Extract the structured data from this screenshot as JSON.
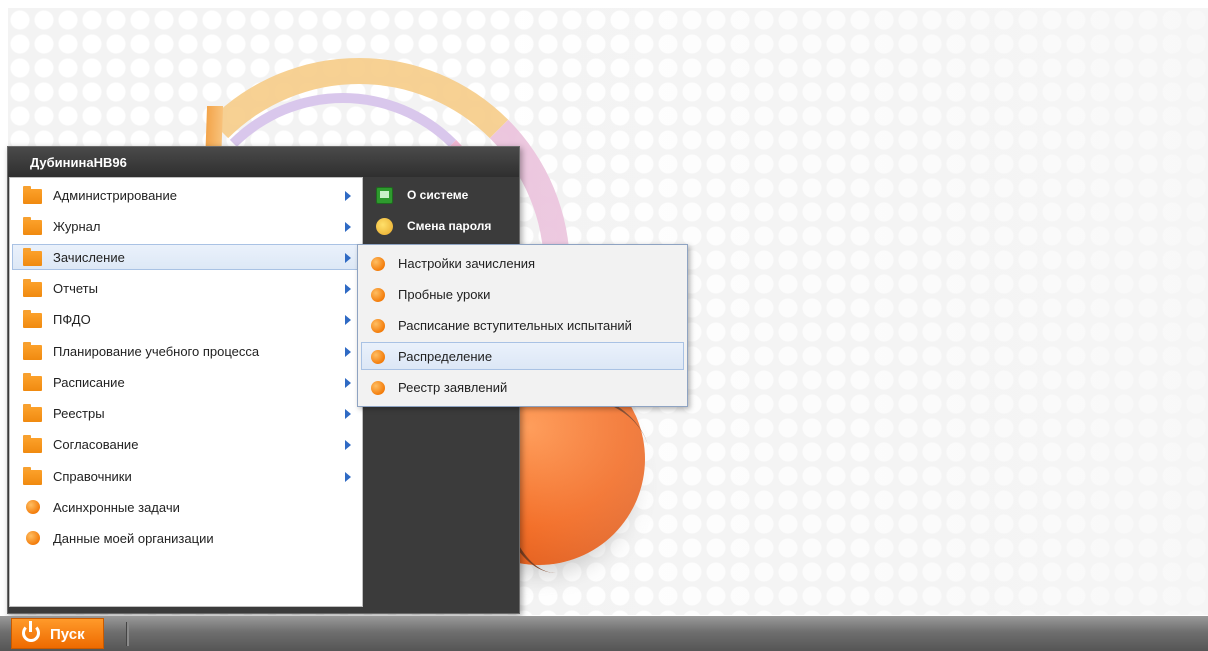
{
  "start_menu": {
    "username": "ДубининаНВ96",
    "items": [
      {
        "label": "Администрирование",
        "icon": "folder-icon",
        "submenu": true
      },
      {
        "label": "Журнал",
        "icon": "folder-icon",
        "submenu": true
      },
      {
        "label": "Зачисление",
        "icon": "folder-icon",
        "submenu": true,
        "selected": true
      },
      {
        "label": "Отчеты",
        "icon": "folder-icon",
        "submenu": true
      },
      {
        "label": "ПФДО",
        "icon": "folder-icon",
        "submenu": true
      },
      {
        "label": "Планирование учебного процесса",
        "icon": "folder-icon",
        "submenu": true
      },
      {
        "label": "Расписание",
        "icon": "folder-icon",
        "submenu": true
      },
      {
        "label": "Реестры",
        "icon": "folder-icon",
        "submenu": true
      },
      {
        "label": "Согласование",
        "icon": "folder-icon",
        "submenu": true
      },
      {
        "label": "Справочники",
        "icon": "folder-icon",
        "submenu": true
      },
      {
        "label": "Асинхронные задачи",
        "icon": "orange-dot-icon",
        "submenu": false
      },
      {
        "label": "Данные моей организации",
        "icon": "orange-dot-icon",
        "submenu": false
      }
    ],
    "right_items": [
      {
        "label": "О системе",
        "icon": "monitor-icon"
      },
      {
        "label": "Смена пароля",
        "icon": "key-icon"
      }
    ]
  },
  "submenu": {
    "parent": "Зачисление",
    "items": [
      {
        "label": "Настройки зачисления"
      },
      {
        "label": "Пробные уроки"
      },
      {
        "label": "Расписание вступительных испытаний"
      },
      {
        "label": "Распределение",
        "selected": true
      },
      {
        "label": "Реестр заявлений"
      }
    ]
  },
  "taskbar": {
    "start_label": "Пуск"
  },
  "colors": {
    "accent_orange": "#f07a10",
    "selection_bg": "#dde8f6",
    "menu_dark": "#3b3b3b"
  }
}
